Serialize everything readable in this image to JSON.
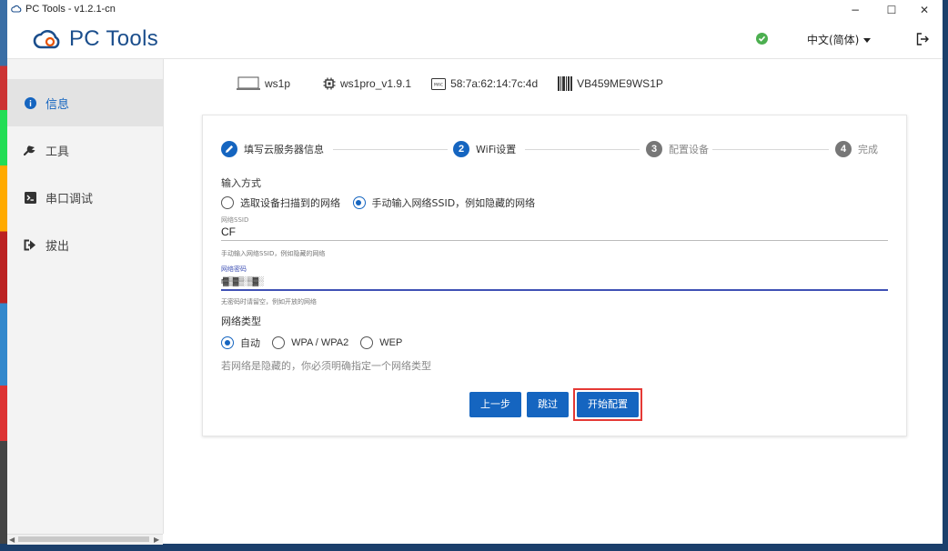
{
  "window": {
    "title": "PC Tools - v1.2.1-cn",
    "controls": {
      "minimize": "−",
      "maximize": "☐",
      "close": "✕"
    }
  },
  "header": {
    "logo_text": "PC Tools",
    "status_icon": "check-circle-icon",
    "status_color": "#4caf50",
    "language": "中文(简体)",
    "logout_icon": "logout-icon"
  },
  "sidebar": {
    "items": [
      {
        "label": "信息",
        "icon": "info-icon",
        "active": true
      },
      {
        "label": "工具",
        "icon": "wrench-icon",
        "active": false
      },
      {
        "label": "串口调试",
        "icon": "terminal-icon",
        "active": false
      },
      {
        "label": "拔出",
        "icon": "eject-icon",
        "active": false
      }
    ]
  },
  "device": {
    "name": "ws1p",
    "firmware": "ws1pro_v1.9.1",
    "mac": "58:7a:62:14:7c:4d",
    "serial": "VB459ME9WS1P",
    "mac_badge": "MAC"
  },
  "stepper": {
    "steps": [
      {
        "number": "✓",
        "label": "填写云服务器信息",
        "state": "done"
      },
      {
        "number": "2",
        "label": "WiFi设置",
        "state": "current"
      },
      {
        "number": "3",
        "label": "配置设备",
        "state": "todo"
      },
      {
        "number": "4",
        "label": "完成",
        "state": "todo"
      }
    ]
  },
  "form": {
    "input_mode_label": "输入方式",
    "mode_options": [
      {
        "label": "选取设备扫描到的网络",
        "checked": false
      },
      {
        "label": "手动输入网络SSID，例如隐藏的网络",
        "checked": true
      }
    ],
    "ssid": {
      "label": "网络SSID",
      "value": "CF",
      "helper": "手动输入网络SSID，例如隐藏的网络"
    },
    "password": {
      "label": "网络密码",
      "value": "r▓▒▓▒░▒▓░",
      "helper": "无密码时请留空，例如开放的网络"
    },
    "network_type_label": "网络类型",
    "type_options": [
      {
        "label": "自动",
        "checked": true
      },
      {
        "label": "WPA / WPA2",
        "checked": false
      },
      {
        "label": "WEP",
        "checked": false
      }
    ],
    "type_hint": "若网络是隐藏的，你必须明确指定一个网络类型"
  },
  "actions": {
    "prev": "上一步",
    "skip": "跳过",
    "start": "开始配置"
  },
  "colors": {
    "primary": "#1565c0",
    "highlight_box": "#e53935",
    "focus_underline": "#3f51b5"
  }
}
